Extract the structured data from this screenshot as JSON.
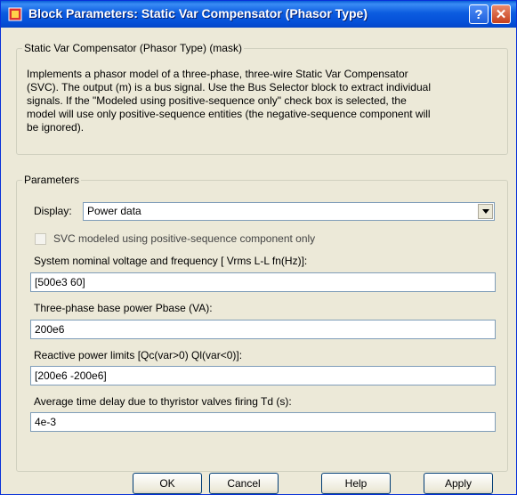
{
  "window": {
    "title": "Block Parameters: Static Var Compensator (Phasor Type)",
    "help_glyph": "?",
    "close_glyph": "✕"
  },
  "mask": {
    "group_title": "Static Var Compensator (Phasor Type) (mask)",
    "lines": [
      "Implements a  phasor model of a three-phase, three-wire Static Var Compensator",
      "(SVC). The output (m) is a bus signal. Use the Bus Selector block to extract individual",
      "signals. If the \"Modeled using positive-sequence only\" check box is selected, the",
      "model will use only positive-sequence entities (the negative-sequence component will",
      "be ignored)."
    ]
  },
  "params": {
    "group_title": "Parameters",
    "display_label": "Display:",
    "display_value": "Power data",
    "checkbox_label": "SVC modeled using  positive-sequence component only",
    "checkbox_checked": false,
    "fields": [
      {
        "label": "System nominal voltage and frequency [ Vrms L-L  fn(Hz)]:",
        "value": "[500e3  60]"
      },
      {
        "label": "Three-phase base power Pbase (VA):",
        "value": "200e6"
      },
      {
        "label": "Reactive power limits [Qc(var>0)  Ql(var<0)]:",
        "value": "[200e6  -200e6]"
      },
      {
        "label": "Average time delay due to thyristor valves firing Td (s):",
        "value": "4e-3"
      }
    ]
  },
  "buttons": {
    "ok": "OK",
    "cancel": "Cancel",
    "help": "Help",
    "apply": "Apply"
  }
}
